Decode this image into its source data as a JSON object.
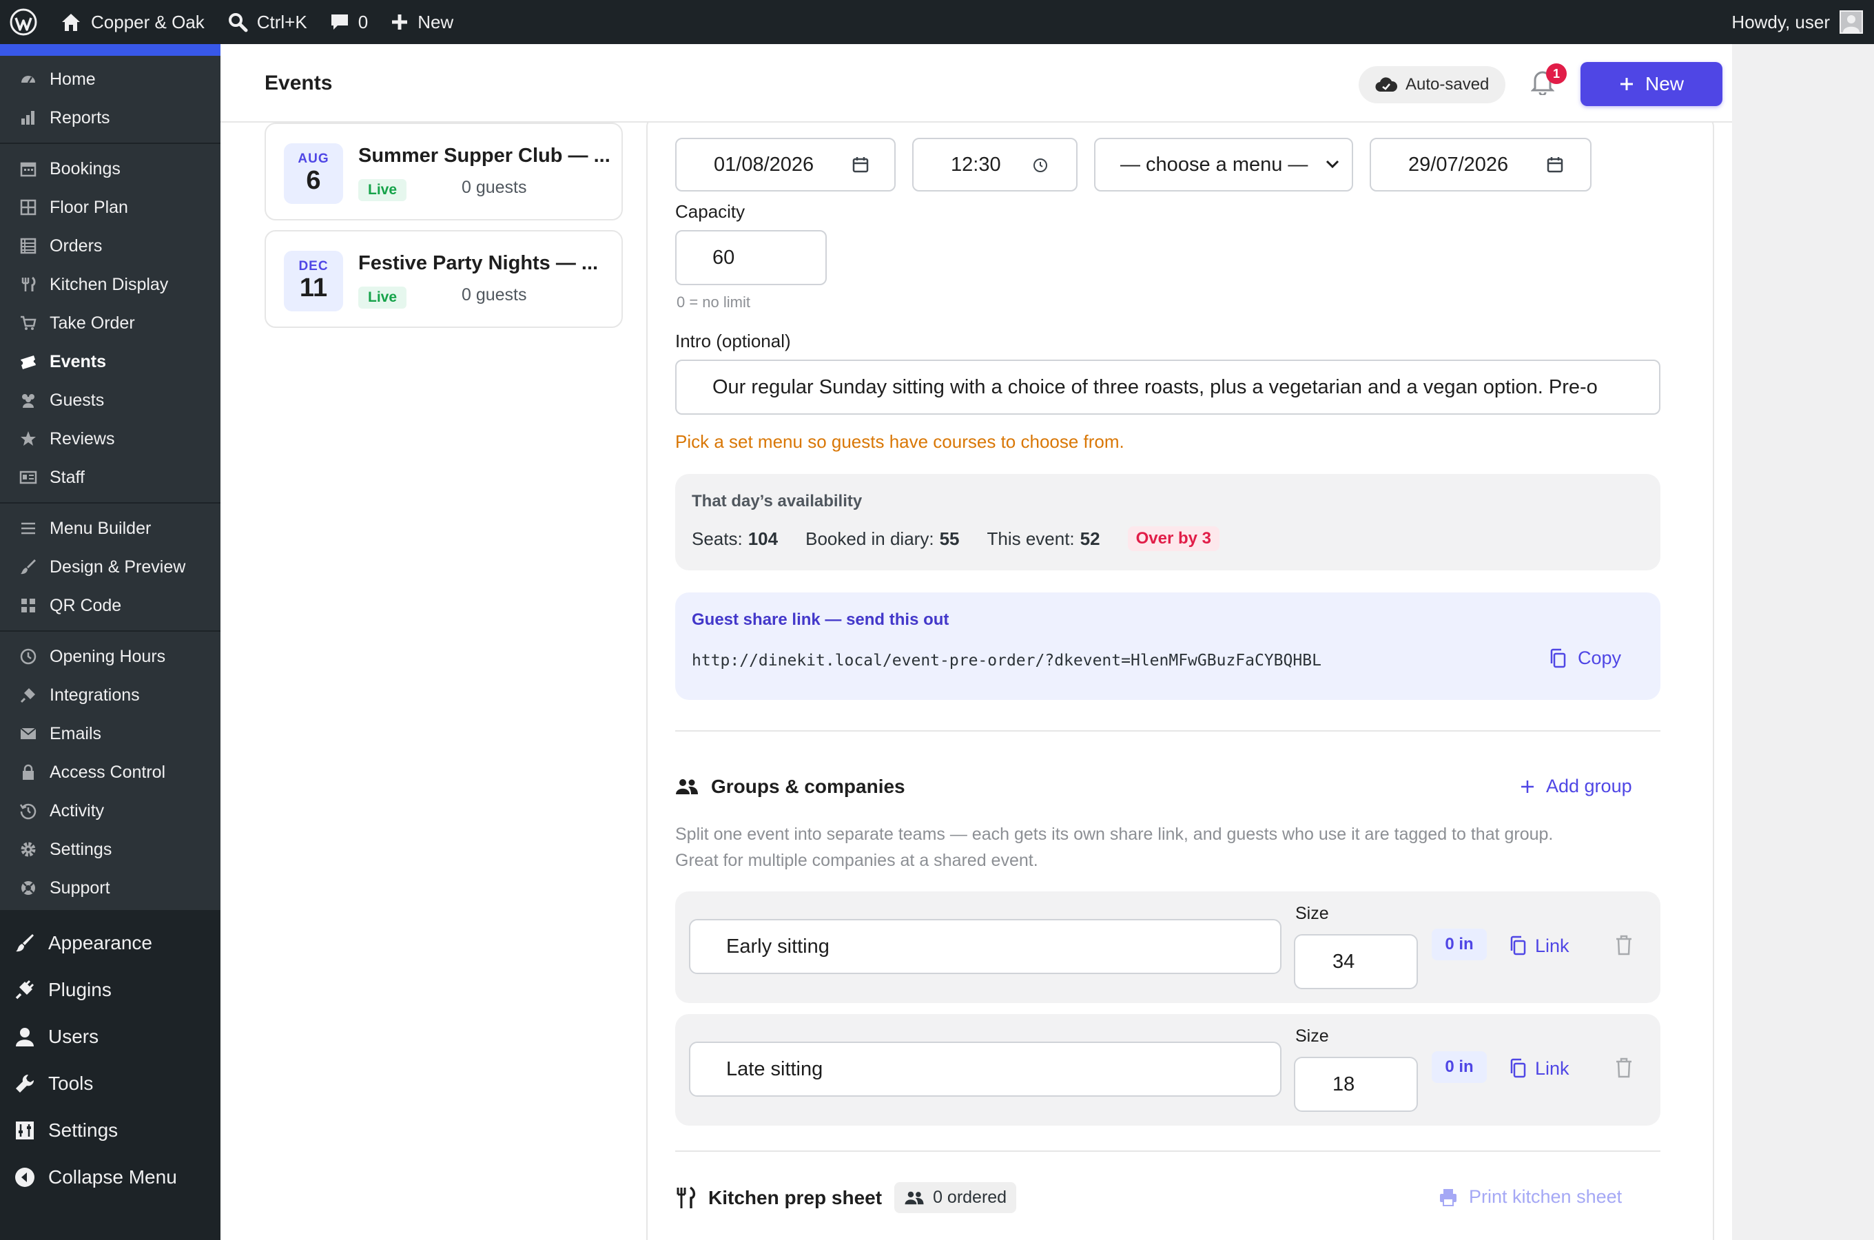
{
  "adminbar": {
    "site_name": "Copper & Oak",
    "search_shortcut": "Ctrl+K",
    "comments_count": "0",
    "new_label": "New",
    "howdy": "Howdy, user"
  },
  "sidebar": {
    "plugin_items": [
      {
        "label": "Home",
        "icon": "dashboard-icon"
      },
      {
        "label": "Reports",
        "icon": "chart-bar-icon"
      },
      {
        "label": "Bookings",
        "icon": "calendar-icon"
      },
      {
        "label": "Floor Plan",
        "icon": "grid-icon"
      },
      {
        "label": "Orders",
        "icon": "list-icon"
      },
      {
        "label": "Kitchen Display",
        "icon": "utensils-icon"
      },
      {
        "label": "Take Order",
        "icon": "cart-icon"
      },
      {
        "label": "Events",
        "icon": "tickets-icon"
      },
      {
        "label": "Guests",
        "icon": "groups-icon"
      },
      {
        "label": "Reviews",
        "icon": "star-icon"
      },
      {
        "label": "Staff",
        "icon": "id-card-icon"
      },
      {
        "label": "Menu Builder",
        "icon": "menu-icon"
      },
      {
        "label": "Design & Preview",
        "icon": "brush-icon"
      },
      {
        "label": "QR Code",
        "icon": "qr-icon"
      },
      {
        "label": "Opening Hours",
        "icon": "clock-icon"
      },
      {
        "label": "Integrations",
        "icon": "plug-icon"
      },
      {
        "label": "Emails",
        "icon": "email-icon"
      },
      {
        "label": "Access Control",
        "icon": "lock-icon"
      },
      {
        "label": "Activity",
        "icon": "history-icon"
      },
      {
        "label": "Settings",
        "icon": "gear-icon"
      },
      {
        "label": "Support",
        "icon": "lifebuoy-icon"
      }
    ],
    "main_items": [
      {
        "label": "Appearance",
        "icon": "paintbrush-icon"
      },
      {
        "label": "Plugins",
        "icon": "plugin-icon"
      },
      {
        "label": "Users",
        "icon": "user-icon"
      },
      {
        "label": "Tools",
        "icon": "wrench-icon"
      },
      {
        "label": "Settings",
        "icon": "sliders-icon"
      },
      {
        "label": "Collapse Menu",
        "icon": "collapse-icon"
      }
    ]
  },
  "header": {
    "title": "Events",
    "autosaved": "Auto-saved",
    "notifications_count": "1",
    "new_label": "New"
  },
  "events": [
    {
      "month": "AUG",
      "day": "6",
      "title": "Summer Supper Club — ...",
      "status": "Live",
      "guests": "0 guests"
    },
    {
      "month": "DEC",
      "day": "11",
      "title": "Festive Party Nights — ...",
      "status": "Live",
      "guests": "0 guests"
    }
  ],
  "editor": {
    "date": "01/08/2026",
    "time": "12:30",
    "menu_select": "— choose a menu —",
    "cutoff_date": "29/07/2026",
    "capacity_label": "Capacity",
    "capacity_value": "60",
    "capacity_help": "0 = no limit",
    "intro_label": "Intro (optional)",
    "intro_value": "Our regular Sunday sitting with a choice of three roasts, plus a vegetarian and a vegan option. Pre-o",
    "menu_warning": "Pick a set menu so guests have courses to choose from.",
    "availability": {
      "title": "That day’s availability",
      "seats_label": "Seats:",
      "seats_value": "104",
      "booked_label": "Booked in diary:",
      "booked_value": "55",
      "event_label": "This event:",
      "event_value": "52",
      "over_badge": "Over by 3"
    },
    "share": {
      "title": "Guest share link — send this out",
      "url": "http://dinekit.local/event-pre-order/?dkevent=HlenMFwGBuzFaCYBQHBL",
      "copy_label": "Copy"
    },
    "groups": {
      "title": "Groups & companies",
      "add_label": "Add group",
      "description_line1": "Split one event into separate teams — each gets its own share link, and guests who use it are tagged to that group.",
      "description_line2": "Great for multiple companies at a shared event.",
      "size_label": "Size",
      "link_label": "Link",
      "rows": [
        {
          "name": "Early sitting",
          "size": "34",
          "in_count": "0 in"
        },
        {
          "name": "Late sitting",
          "size": "18",
          "in_count": "0 in"
        }
      ]
    },
    "kitchen": {
      "title": "Kitchen prep sheet",
      "ordered_badge": "0 ordered",
      "print_label": "Print kitchen sheet"
    }
  },
  "colors": {
    "accent": "#4f46e5",
    "admin_bg": "#1d2327",
    "live_green": "#16a34a",
    "warning": "#d97706",
    "danger": "#e11d48"
  }
}
